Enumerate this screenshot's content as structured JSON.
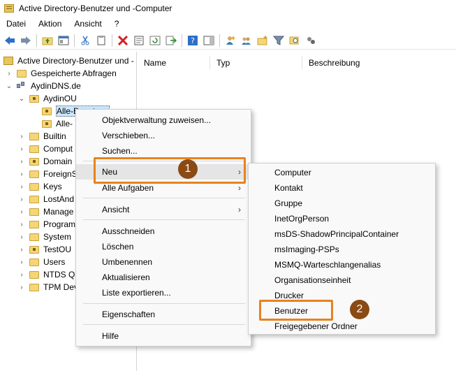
{
  "window": {
    "title": "Active Directory-Benutzer und -Computer"
  },
  "menubar": {
    "items": [
      "Datei",
      "Aktion",
      "Ansicht",
      "?"
    ]
  },
  "toolbar": {
    "icons": [
      "back-arrow-icon",
      "forward-arrow-icon",
      "up-folder-icon",
      "console-tree-icon",
      "cut-icon",
      "copy-icon",
      "delete-icon",
      "properties-icon",
      "refresh-icon",
      "export-icon",
      "help-icon",
      "show-pane-icon",
      "add-user-icon",
      "add-group-icon",
      "add-ou-icon",
      "filter-icon",
      "find-icon",
      "delegate-icon"
    ]
  },
  "tree": {
    "root": "Active Directory-Benutzer und -",
    "saved_queries": "Gespeicherte Abfragen",
    "domain": "AydinDNS.de",
    "ou": "AydinOU",
    "selected": "Alle-Benutzer",
    "sibling": "Alle-",
    "children": [
      "Builtin",
      "Comput",
      "Domain",
      "ForeignS",
      "Keys",
      "LostAnd",
      "Manage",
      "Program",
      "System",
      "TestOU",
      "Users",
      "NTDS Qu",
      "TPM Dev"
    ]
  },
  "list": {
    "columns": [
      "Name",
      "Typ",
      "Beschreibung"
    ]
  },
  "context_menu": {
    "group1": [
      "Objektverwaltung zuweisen...",
      "Verschieben...",
      "Suchen..."
    ],
    "neu": "Neu",
    "alle_aufgaben": "Alle Aufgaben",
    "ansicht": "Ansicht",
    "group3": [
      "Ausschneiden",
      "Löschen",
      "Umbenennen",
      "Aktualisieren",
      "Liste exportieren..."
    ],
    "eigenschaften": "Eigenschaften",
    "hilfe": "Hilfe"
  },
  "submenu": {
    "items": [
      "Computer",
      "Kontakt",
      "Gruppe",
      "InetOrgPerson",
      "msDS-ShadowPrincipalContainer",
      "msImaging-PSPs",
      "MSMQ-Warteschlangenalias",
      "Organisationseinheit",
      "Drucker",
      "Benutzer",
      "Freigegebener Ordner"
    ]
  },
  "annotations": {
    "step1": "1",
    "step2": "2"
  },
  "colors": {
    "accent_orange": "#e8821e",
    "badge_brown": "#8b4a14",
    "selection": "#cde8ff"
  }
}
